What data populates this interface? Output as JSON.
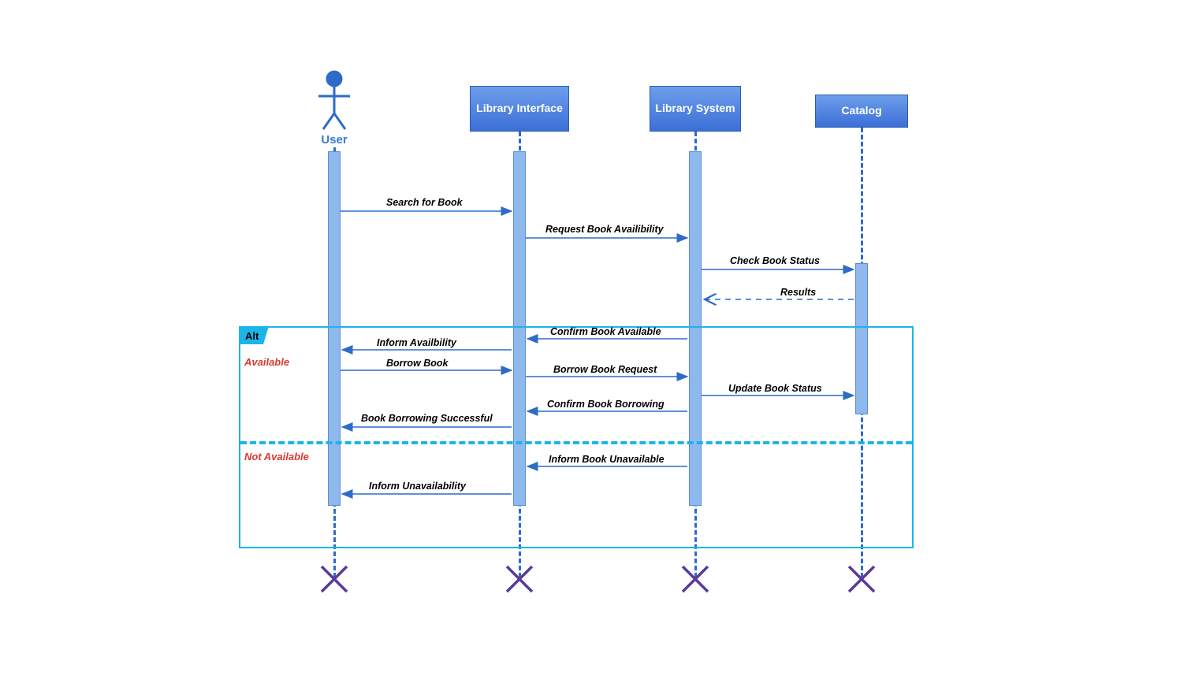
{
  "participants": {
    "user": "User",
    "library_interface": "Library Interface",
    "library_system": "Library System",
    "catalog": "Catalog"
  },
  "fragment": {
    "operator": "Alt",
    "cond_available": "Available",
    "cond_not_available": "Not Available"
  },
  "messages": {
    "m1": "Search for Book",
    "m2": "Request Book Availibility",
    "m3": "Check Book Status",
    "m4": "Results",
    "m5": "Confirm Book Available",
    "m6": "Inform Availbility",
    "m7": "Borrow Book",
    "m8": "Borrow Book Request",
    "m9": "Update Book Status",
    "m10": "Confirm Book Borrowing",
    "m11": "Book Borrowing Successful",
    "m12": "Inform Book Unavailable",
    "m13": "Inform Unavailability"
  }
}
